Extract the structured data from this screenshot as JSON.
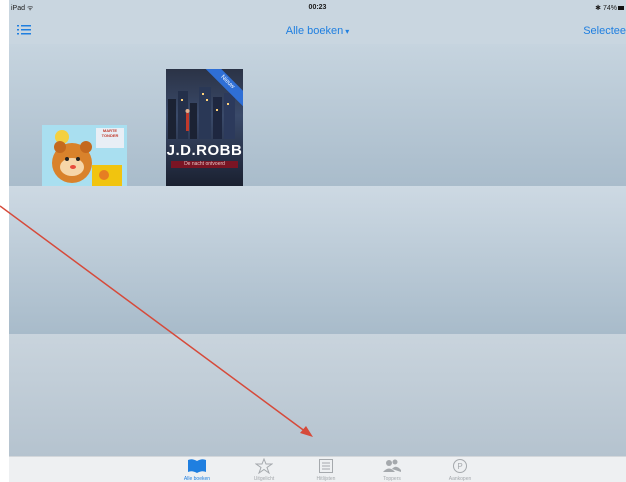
{
  "status_bar": {
    "carrier": "iPad ᯤ",
    "time": "00:23",
    "battery": "✱ 74%"
  },
  "navbar": {
    "title": "Alle boeken",
    "caret": "▾",
    "select_label": "Selectee"
  },
  "books": [
    {
      "kind": "children-book",
      "cover_title": "MARTE TONDER",
      "bg_color": "#a9dff0"
    },
    {
      "kind": "novel",
      "author": "J.D.ROBB",
      "subtitle": "De nacht ontvoerd",
      "badge": "Nieuw",
      "bg_color": "#2b3346"
    }
  ],
  "tabbar": {
    "tabs": [
      {
        "label": "Alle boeken",
        "icon": "open-book-icon",
        "active": true
      },
      {
        "label": "Uitgelicht",
        "icon": "star-icon",
        "active": false
      },
      {
        "label": "Hitlijsten",
        "icon": "list-icon",
        "active": false
      },
      {
        "label": "Toppers",
        "icon": "people-icon",
        "active": false
      },
      {
        "label": "Aankopen",
        "icon": "purchased-icon",
        "active": false
      }
    ]
  },
  "colors": {
    "accent": "#1f7fe0",
    "arrow": "#d64a3a"
  }
}
